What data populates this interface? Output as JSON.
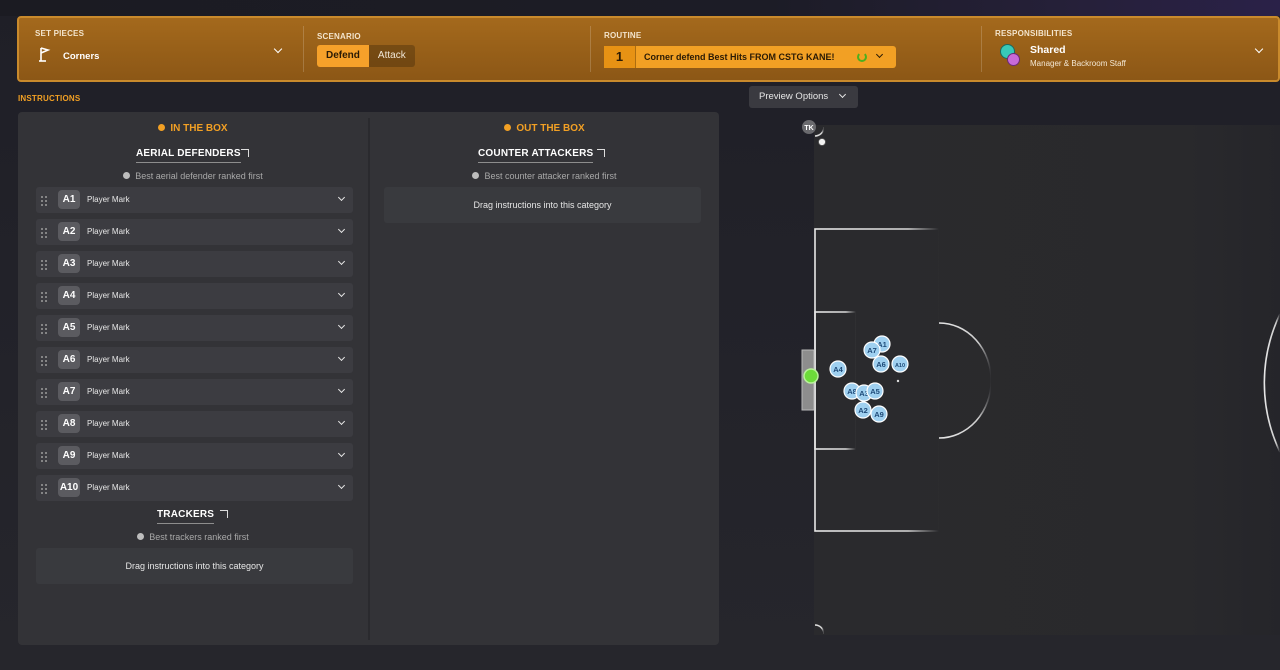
{
  "header": {
    "set_pieces": {
      "label": "SET PIECES",
      "value": "Corners"
    },
    "scenario": {
      "label": "SCENARIO",
      "options": [
        "Defend",
        "Attack"
      ],
      "selected": "Defend"
    },
    "routine": {
      "label": "ROUTINE",
      "number": "1",
      "name": "Corner defend Best Hits FROM CSTG KANE!"
    },
    "responsibilities": {
      "label": "RESPONSIBILITIES",
      "value": "Shared",
      "sub": "Manager & Backroom Staff"
    }
  },
  "instructions": {
    "title": "INSTRUCTIONS",
    "in_box": {
      "heading": "IN THE BOX",
      "aerial": {
        "title": "AERIAL DEFENDERS",
        "hint": "Best aerial defender ranked first",
        "rows": [
          {
            "badge": "A1",
            "label": "Player Mark"
          },
          {
            "badge": "A2",
            "label": "Player Mark"
          },
          {
            "badge": "A3",
            "label": "Player Mark"
          },
          {
            "badge": "A4",
            "label": "Player Mark"
          },
          {
            "badge": "A5",
            "label": "Player Mark"
          },
          {
            "badge": "A6",
            "label": "Player Mark"
          },
          {
            "badge": "A7",
            "label": "Player Mark"
          },
          {
            "badge": "A8",
            "label": "Player Mark"
          },
          {
            "badge": "A9",
            "label": "Player Mark"
          },
          {
            "badge": "A10",
            "label": "Player Mark"
          }
        ]
      },
      "trackers": {
        "title": "TRACKERS",
        "hint": "Best trackers ranked first",
        "drop": "Drag instructions into this category"
      }
    },
    "out_box": {
      "heading": "OUT THE BOX",
      "counter": {
        "title": "COUNTER ATTACKERS",
        "hint": "Best counter attacker ranked first",
        "drop": "Drag instructions into this category"
      }
    }
  },
  "preview": {
    "button": "Preview Options",
    "taker_label": "TK",
    "markers": [
      "A1",
      "A7",
      "A6",
      "A10",
      "A4",
      "A8",
      "A3",
      "A5",
      "A2",
      "A9"
    ]
  },
  "colors": {
    "accent": "#f2a024",
    "header_bg": "#9a6119",
    "panel_bg": "#333337",
    "marker": "#9fd0f0"
  }
}
